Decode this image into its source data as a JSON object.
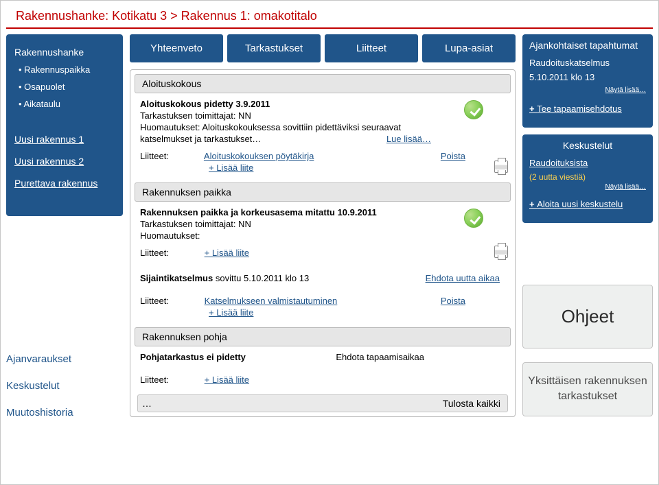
{
  "breadcrumb": {
    "project": "Rakennushanke: Kotikatu 3",
    "sep": " > ",
    "building": "Rakennus 1: omakotitalo"
  },
  "sidebar": {
    "top": "Rakennushanke",
    "items": [
      "Rakennuspaikka",
      "Osapuolet",
      "Aikataulu"
    ],
    "buildings": [
      "Uusi rakennus 1",
      "Uusi rakennus 2",
      "Purettava rakennus"
    ],
    "bottom": [
      "Ajanvaraukset",
      "Keskustelut",
      "Muutoshistoria"
    ]
  },
  "tabs": [
    "Yhteenveto",
    "Tarkastukset",
    "Liitteet",
    "Lupa-asiat"
  ],
  "sections": {
    "s1": {
      "header": "Aloituskokous",
      "title": "Aloituskokous pidetty 3.9.2011",
      "line2": "Tarkastuksen toimittajat: NN",
      "line3a": "Huomautukset: Aloituskokouksessa sovittiin pidettäviksi seuraavat",
      "line3b": "katselmukset ja tarkastukset…",
      "read_more": "Lue lisää…",
      "att_label": "Liitteet:",
      "att_link": "Aloituskokouksen pöytäkirja",
      "remove": "Poista",
      "add": "+ Lisää liite"
    },
    "s2": {
      "header": "Rakennuksen paikka",
      "title": "Rakennuksen paikka ja korkeusasema mitattu 10.9.2011",
      "line2": "Tarkastuksen toimittajat: NN",
      "line3": "Huomautukset:",
      "att_label": "Liitteet:",
      "add": "+ Lisää liite"
    },
    "s3": {
      "title_a": "Sijaintikatselmus",
      "title_b": "sovittu 5.10.2011 klo 13",
      "suggest": "Ehdota uutta aikaa",
      "att_label": "Liitteet:",
      "att_link": "Katselmukseen valmistautuminen",
      "remove": "Poista",
      "add": "+ Lisää liite"
    },
    "s4": {
      "header": "Rakennuksen pohja",
      "title": "Pohjatarkastus ei pidetty",
      "suggest": "Ehdota tapaamisaikaa",
      "att_label": "Liitteet:",
      "add": "+ Lisää liite"
    },
    "footer": {
      "dots": "…",
      "print_all": "Tulosta kaikki"
    }
  },
  "right": {
    "events": {
      "header": "Ajankohtaiset tapahtumat",
      "item1": "Raudoituskatselmus",
      "item1_time": "5.10.2011 klo 13",
      "more": "Näytä lisää…",
      "add": "Tee tapaamisehdotus"
    },
    "chats": {
      "header": "Keskustelut",
      "topic": "Raudoituksista",
      "unread": "(2 uutta viestiä)",
      "more": "Näytä lisää…",
      "add": "Aloita uusi keskustelu"
    },
    "ohjeet": "Ohjeet",
    "infobox": "Yksittäisen rakennuksen tarkastukset"
  }
}
